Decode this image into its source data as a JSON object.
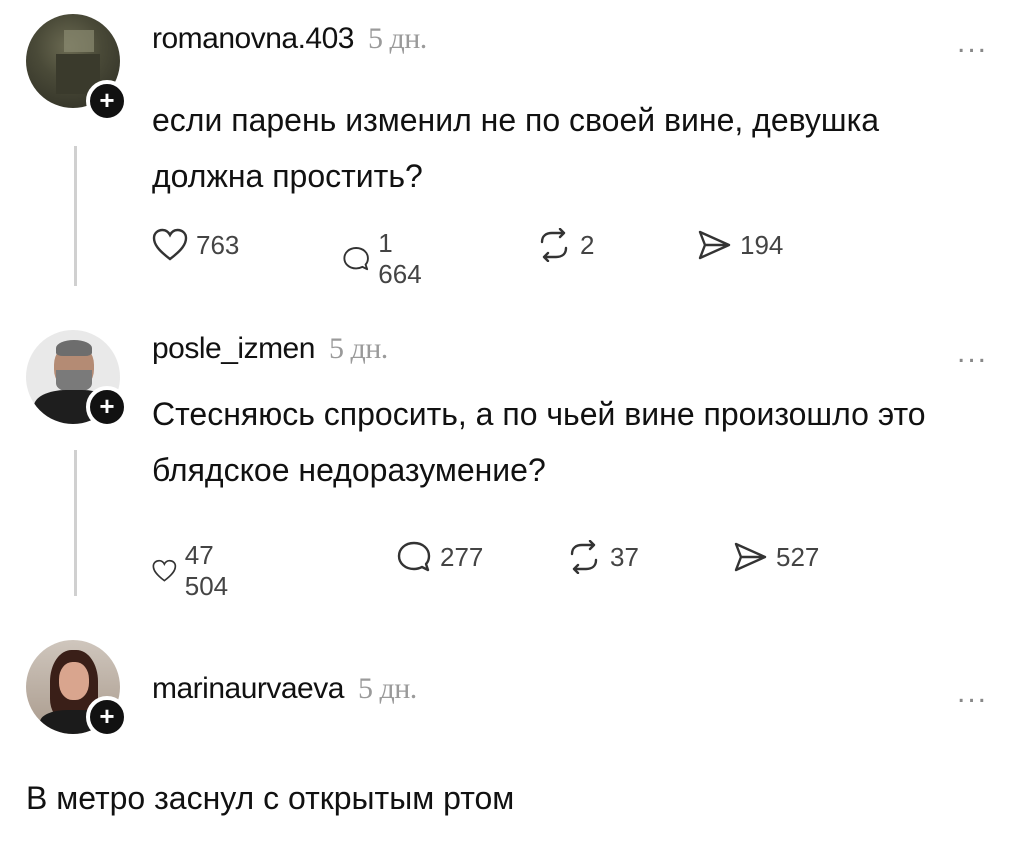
{
  "posts": [
    {
      "username": "romanovna.403",
      "time": "5 дн.",
      "more": "...",
      "text": "если парень изменил не по своей вине, девушка должна простить?",
      "likes": "763",
      "comments": "1 664",
      "reposts": "2",
      "shares": "194"
    },
    {
      "username": "posle_izmen",
      "time": "5 дн.",
      "more": "...",
      "text": "Стесняюсь спросить, а по чьей вине произошло это блядское недоразумение?",
      "likes": "47 504",
      "comments": "277",
      "reposts": "37",
      "shares": "527"
    },
    {
      "username": "marinaurvaeva",
      "time": "5 дн.",
      "more": "..."
    }
  ],
  "caption": "В метро заснул с открытым ртом",
  "icons": {
    "follow": "plus-icon",
    "like": "heart-icon",
    "comment": "comment-bubble-icon",
    "repost": "repost-icon",
    "share": "send-icon"
  }
}
